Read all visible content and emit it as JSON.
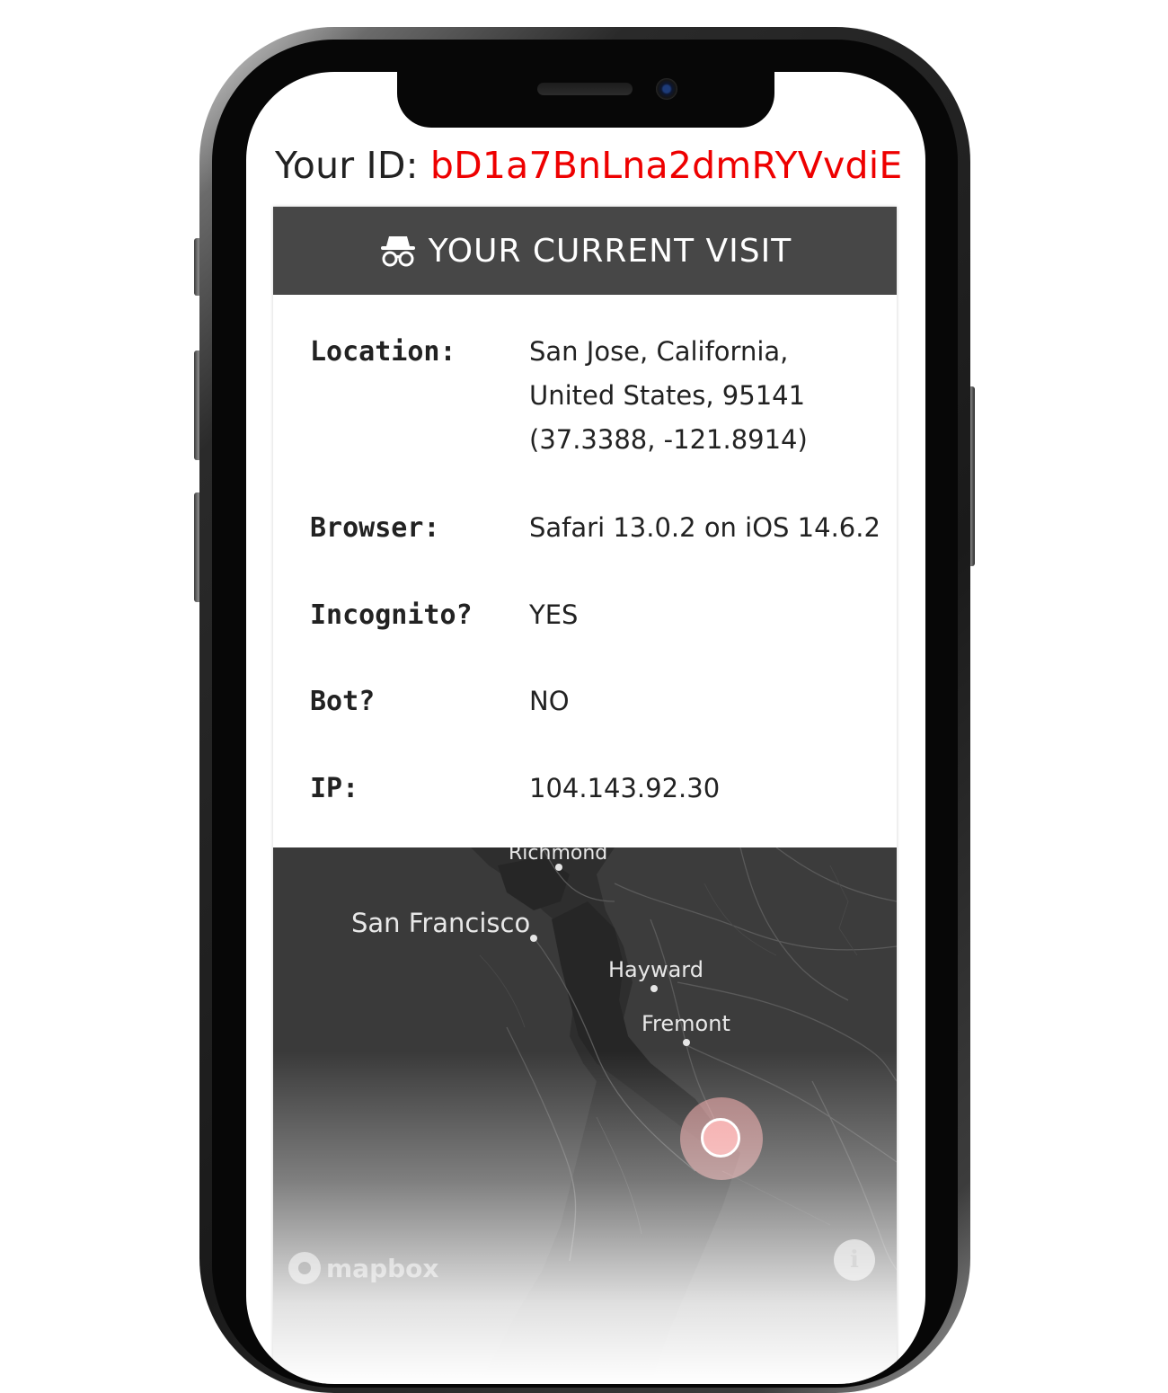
{
  "device": {
    "model": "iPhone"
  },
  "header": {
    "id_label": "Your ID:",
    "id_value": "bD1a7BnLna2dmRYVvdiE",
    "id_color": "#ee0000"
  },
  "card": {
    "icon": "incognito-spy-icon",
    "title": "YOUR CURRENT VISIT",
    "header_color": "#474747",
    "rows": [
      {
        "label": "Location:",
        "value_lines": [
          "San Jose, California,",
          "United States, 95141",
          "(37.3388, -121.8914)"
        ]
      },
      {
        "label": "Browser:",
        "value": "Safari 13.0.2 on iOS 14.6.2"
      },
      {
        "label": "Incognito?",
        "value": "YES"
      },
      {
        "label": "Bot?",
        "value": "NO"
      },
      {
        "label": "IP:",
        "value": "104.143.92.30"
      }
    ]
  },
  "map": {
    "provider_logo": "mapbox",
    "info_icon": "info-icon",
    "cities": [
      "Richmond",
      "San Francisco",
      "Hayward",
      "Fremont"
    ],
    "marker_color": "#f3a3a3",
    "marker_icon": "location-marker"
  }
}
